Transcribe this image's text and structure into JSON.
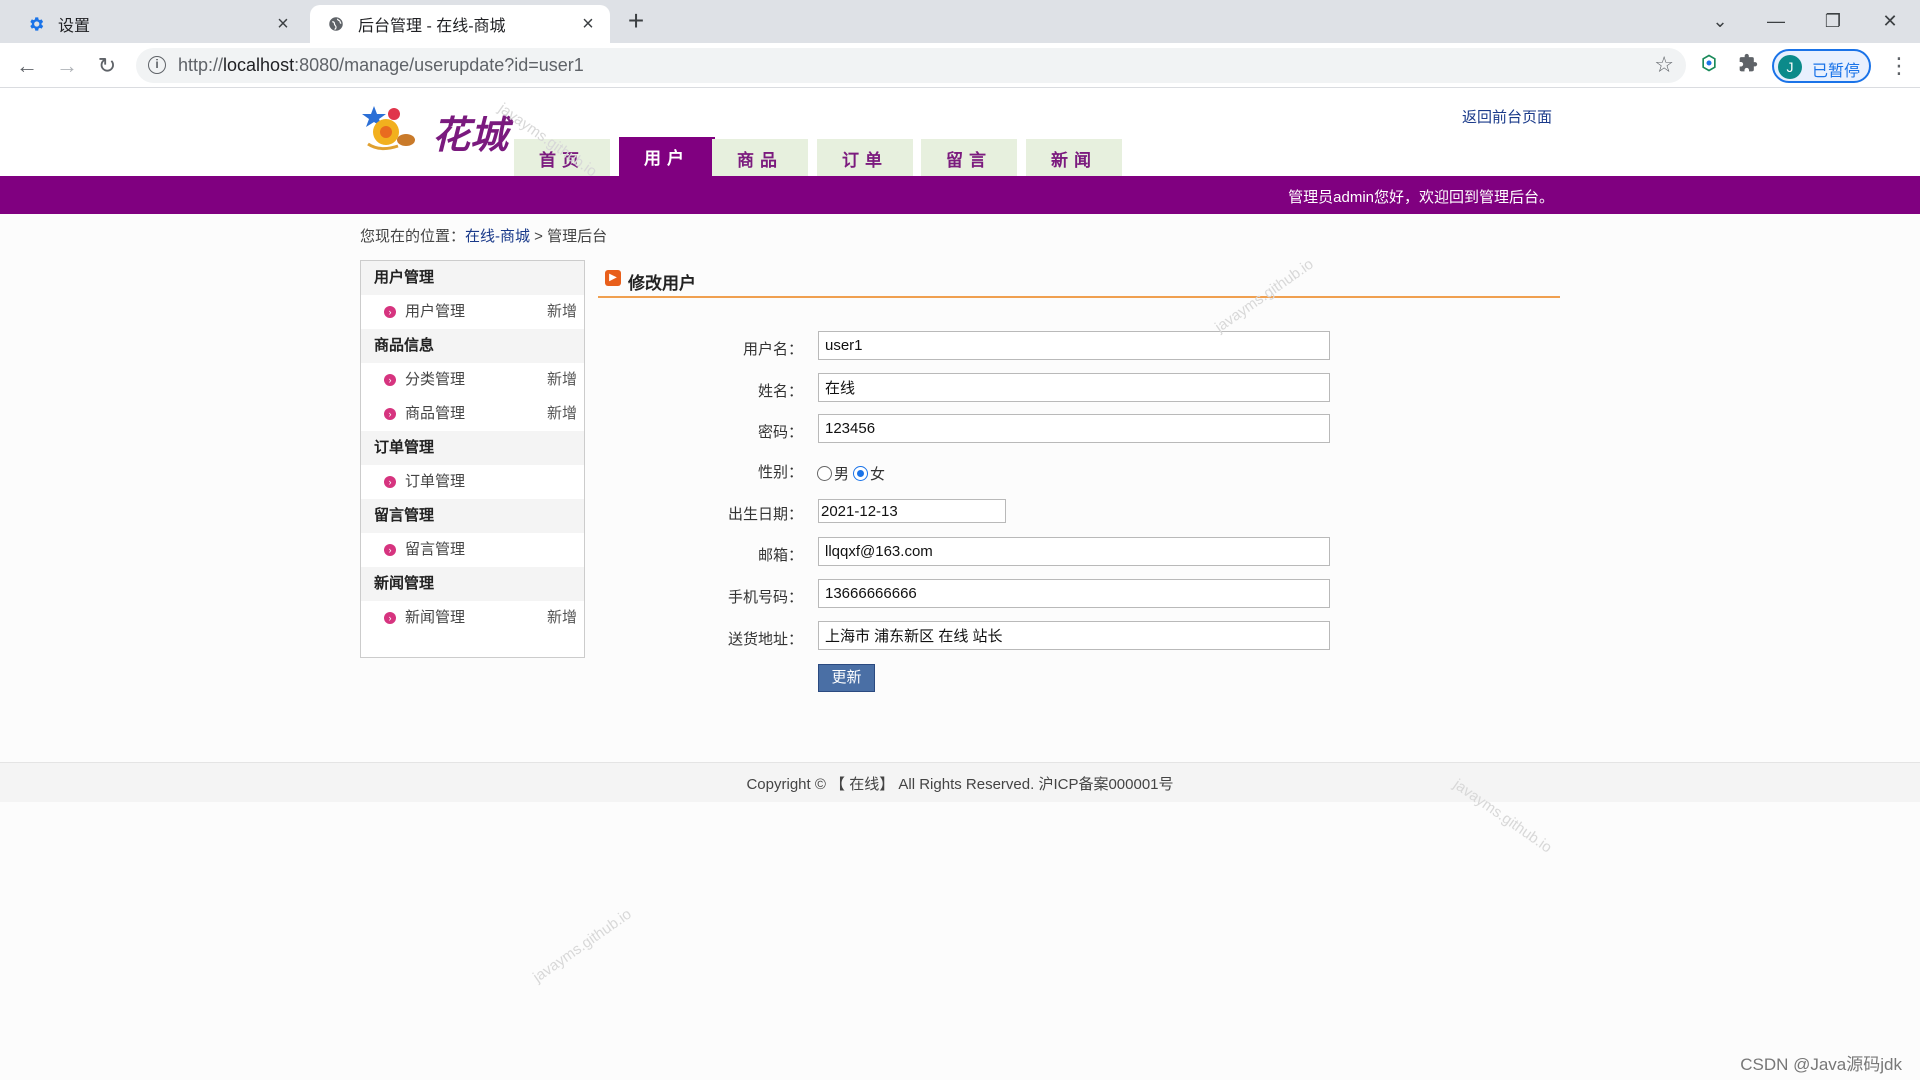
{
  "browser": {
    "tabs": [
      {
        "title": "设置",
        "active": false,
        "icon": "gear-icon"
      },
      {
        "title": "后台管理 - 在线-商城",
        "active": true,
        "icon": "globe-icon"
      }
    ],
    "url_prefix": "http://",
    "url_host": "localhost",
    "url_rest": ":8080/manage/userupdate?id=user1",
    "profile_initial": "J",
    "profile_status": "已暂停"
  },
  "header": {
    "logo_text": "花城",
    "back_link": "返回前台页面",
    "nav": [
      "首页",
      "用户",
      "商品",
      "订单",
      "留言",
      "新闻"
    ],
    "active_nav": "用户",
    "welcome": "管理员admin您好，欢迎回到管理后台。"
  },
  "breadcrumb": {
    "prefix": "您现在的位置：",
    "link": "在线-商城",
    "sep": " > ",
    "current": "管理后台"
  },
  "sidebar": {
    "groups": [
      {
        "title": "用户管理",
        "items": [
          {
            "label": "用户管理",
            "add": "新增"
          }
        ]
      },
      {
        "title": "商品信息",
        "items": [
          {
            "label": "分类管理",
            "add": "新增"
          },
          {
            "label": "商品管理",
            "add": "新增"
          }
        ]
      },
      {
        "title": "订单管理",
        "items": [
          {
            "label": "订单管理",
            "add": ""
          }
        ]
      },
      {
        "title": "留言管理",
        "items": [
          {
            "label": "留言管理",
            "add": ""
          }
        ]
      },
      {
        "title": "新闻管理",
        "items": [
          {
            "label": "新闻管理",
            "add": "新增"
          }
        ]
      }
    ]
  },
  "form": {
    "title": "修改用户",
    "username_label": "用户名：",
    "username": "user1",
    "name_label": "姓名：",
    "name": "在线",
    "password_label": "密码：",
    "password": "123456",
    "gender_label": "性别：",
    "gender_male": "男",
    "gender_female": "女",
    "gender_selected": "女",
    "birthday_label": "出生日期：",
    "birthday": "2021-12-13",
    "email_label": "邮箱：",
    "email": "llqqxf@163.com",
    "phone_label": "手机号码：",
    "phone": "13666666666",
    "address_label": "送货地址：",
    "address": "上海市 浦东新区 在线 站长",
    "submit_label": "更新"
  },
  "footer": {
    "text": "Copyright © 【 在线】 All Rights Reserved. 沪ICP备案000001号"
  },
  "watermark": "javayms.github.io",
  "csdn_mark": "CSDN @Java源码jdk"
}
